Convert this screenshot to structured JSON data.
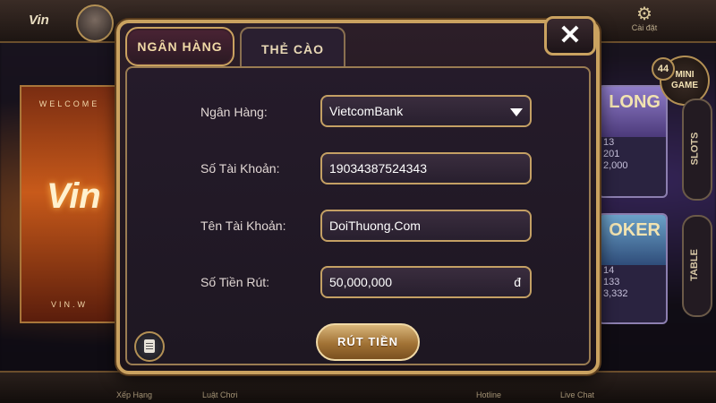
{
  "background": {
    "logo": "Vin",
    "setting_label": "Cài đặt",
    "welcome_top": "WELCOME",
    "welcome_logo": "Vin",
    "welcome_bottom": "VIN.W",
    "card1": {
      "title": "LONG",
      "line1": "13",
      "line2": "201",
      "line3": "2,000"
    },
    "card2": {
      "title": "OKER",
      "line1": "14",
      "line2": "133",
      "line3": "3,332"
    },
    "minigame_badge": "44",
    "minigame_label": "MINI GAME",
    "side_slots": "SLOTS",
    "side_table": "TABLE",
    "bottom_items": [
      "Xếp Hạng",
      "Luật Chơi",
      "Hotline",
      "Live Chat"
    ]
  },
  "dialog": {
    "tabs": [
      {
        "label": "NGÂN HÀNG",
        "active": true
      },
      {
        "label": "THẺ CÀO",
        "active": false
      }
    ],
    "close_label": "✕",
    "form": {
      "bank": {
        "label": "Ngân Hàng:",
        "value": "VietcomBank"
      },
      "account_number": {
        "label": "Số Tài Khoản:",
        "value": "19034387524343"
      },
      "account_name": {
        "label": "Tên Tài Khoản:",
        "value": "DoiThuong.Com"
      },
      "amount": {
        "label": "Số Tiền Rút:",
        "value": "50,000,000",
        "currency": "đ"
      }
    },
    "submit_label": "RÚT TIỀN"
  },
  "colors": {
    "gold_border": "#caa260",
    "panel_bg": "#251b2a",
    "field_bg": "#3a2d3e",
    "button_gold": "#a17235"
  },
  "icons": [
    "close-icon",
    "dropdown-caret-icon",
    "history-document-icon",
    "gear-icon"
  ]
}
